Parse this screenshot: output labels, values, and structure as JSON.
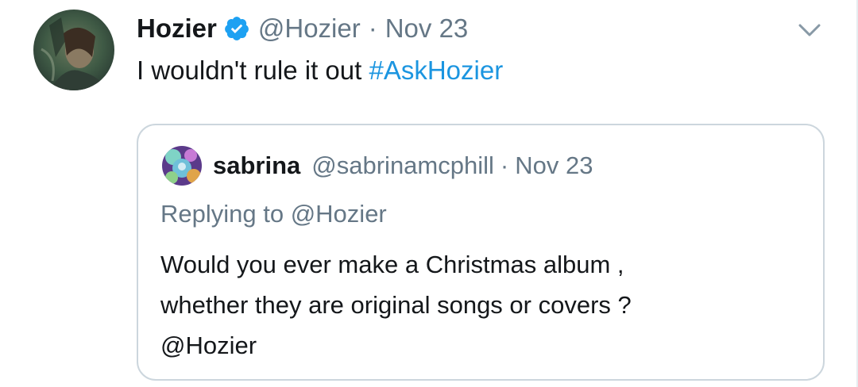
{
  "tweet": {
    "display_name": "Hozier",
    "handle": "@Hozier",
    "separator": "·",
    "date": "Nov 23",
    "text": "I wouldn't rule it out",
    "hashtag": "#AskHozier",
    "avatar_icon": "profile-photo-icon",
    "verified_icon": "verified-badge-icon",
    "menu_icon": "chevron-down-icon"
  },
  "quoted": {
    "display_name": "sabrina",
    "handle": "@sabrinamcphill",
    "separator": "·",
    "date": "Nov 23",
    "replying_to": "Replying to @Hozier",
    "lines": [
      "Would you ever make a Christmas album ,",
      "whether they are original songs or covers ?",
      "@Hozier"
    ],
    "avatar_icon": "profile-photo-icon"
  },
  "colors": {
    "text": "#14171a",
    "secondary": "#657786",
    "link": "#1b95e0",
    "verified": "#1da1f2",
    "border": "#ccd6dd"
  }
}
